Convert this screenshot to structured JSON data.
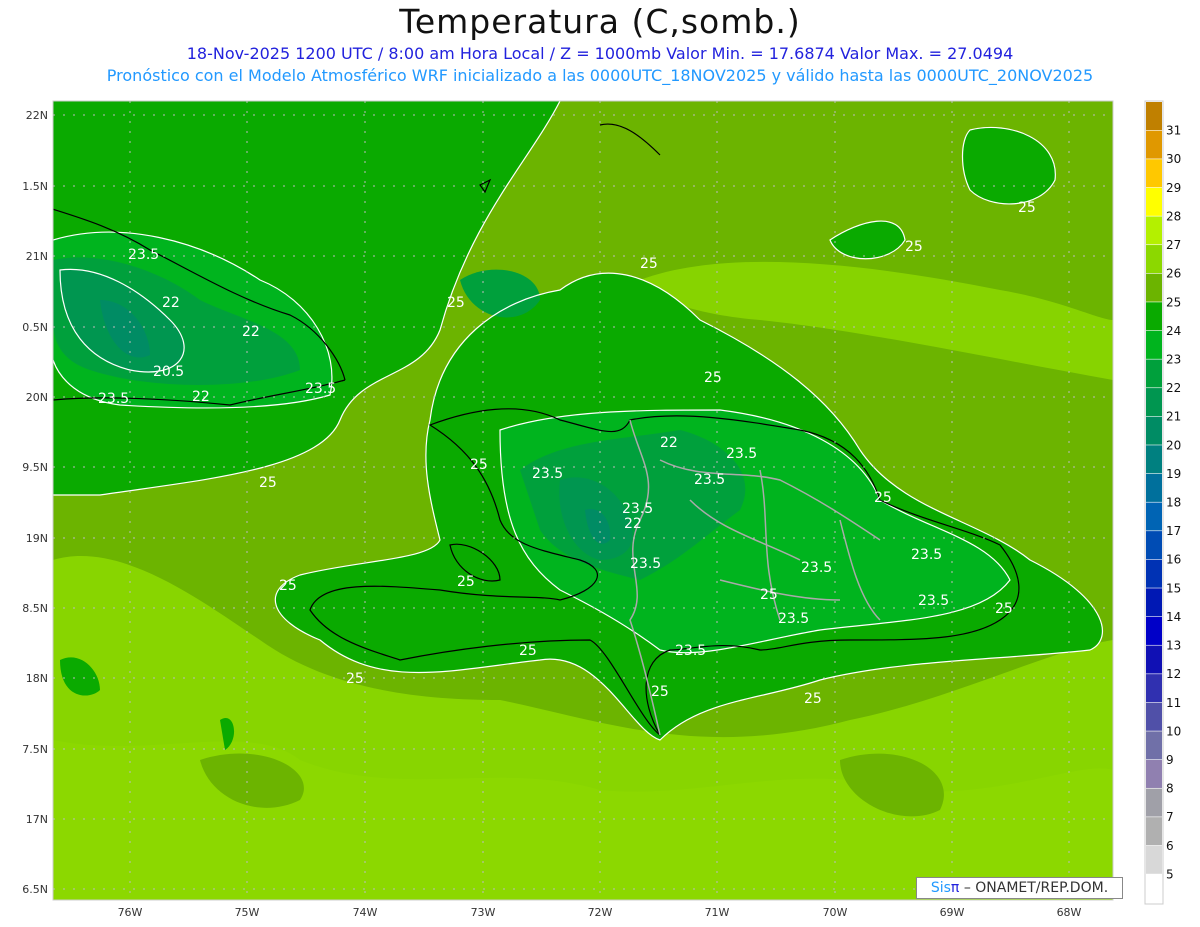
{
  "header": {
    "title": "Temperatura (C,somb.)",
    "subtitle_line1": "18-Nov-2025  1200 UTC / 8:00 am Hora Local / Z = 1000mb   Valor Min. = 17.6874  Valor Max. = 27.0494",
    "subtitle_line2": "Pronóstico con el Modelo Atmosférico WRF inicializado a las 0000UTC_18NOV2025 y válido hasta las  0000UTC_20NOV2025"
  },
  "map": {
    "variable": "Temperatura",
    "units": "C",
    "level": "1000mb",
    "value_min": 17.6874,
    "value_max": 27.0494,
    "lon_ticks": [
      "76W",
      "75W",
      "74W",
      "73W",
      "72W",
      "71W",
      "70W",
      "69W",
      "68W"
    ],
    "lat_ticks": [
      "22N",
      "1.5N",
      "21N",
      "0.5N",
      "20N",
      "9.5N",
      "19N",
      "8.5N",
      "18N",
      "7.5N",
      "17N",
      "6.5N"
    ],
    "contour_labels": [
      "23.5",
      "22",
      "22",
      "20.5",
      "22",
      "23.5",
      "23.5",
      "25",
      "25",
      "25",
      "25",
      "25",
      "25",
      "25",
      "22",
      "23.5",
      "23.5",
      "23.5",
      "23.5",
      "22",
      "25",
      "23.5",
      "25",
      "25",
      "23.5",
      "23.5",
      "25",
      "23.5",
      "25",
      "23.5",
      "25",
      "23.5",
      "25",
      "25",
      "25"
    ]
  },
  "colorbar": {
    "labels": [
      "31",
      "30",
      "29",
      "28",
      "27",
      "26",
      "25",
      "24",
      "23",
      "22",
      "21",
      "20",
      "19",
      "18",
      "17",
      "16",
      "15",
      "14",
      "13",
      "12",
      "11",
      "10",
      "9",
      "8",
      "7",
      "6",
      "5"
    ],
    "colors": [
      "#c08000",
      "#e09800",
      "#ffc800",
      "#ffff00",
      "#b4f000",
      "#8cd800",
      "#6cb400",
      "#0aaa00",
      "#00b41e",
      "#00a03c",
      "#009650",
      "#008c64",
      "#008080",
      "#00709c",
      "#0064b4",
      "#004cb4",
      "#0032b4",
      "#0018b4",
      "#0000c8",
      "#1010b4",
      "#3030b0",
      "#5050a8",
      "#7070a8",
      "#9080b0",
      "#a0a0a8",
      "#b0b0b0",
      "#d8d8d8",
      "#ffffff"
    ]
  },
  "credit": {
    "sis": "Sis",
    "pi": "π",
    "text": "– ONAMET/REP.DOM."
  }
}
